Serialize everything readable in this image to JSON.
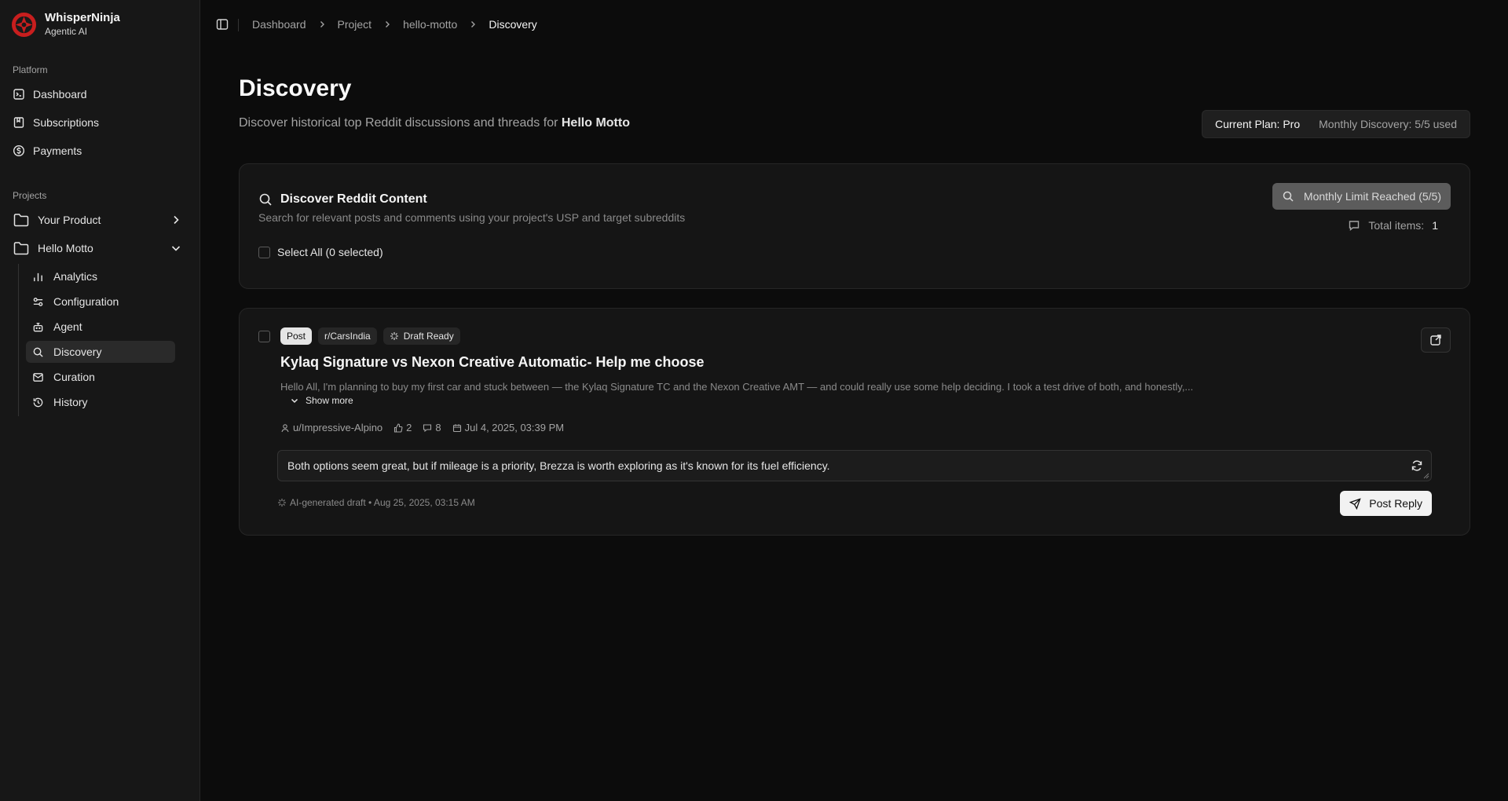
{
  "brand": {
    "name": "WhisperNinja",
    "subtitle": "Agentic AI"
  },
  "sidebar": {
    "platform_label": "Platform",
    "platform_items": [
      {
        "label": "Dashboard",
        "icon": "dashboard-icon"
      },
      {
        "label": "Subscriptions",
        "icon": "book-icon"
      },
      {
        "label": "Payments",
        "icon": "dollar-circle-icon"
      }
    ],
    "projects_label": "Projects",
    "projects": [
      {
        "label": "Your Product",
        "icon": "folder-icon",
        "state": "collapsed"
      },
      {
        "label": "Hello Motto",
        "icon": "folder-icon",
        "state": "expanded"
      }
    ],
    "sub_items": [
      {
        "label": "Analytics",
        "icon": "bar-chart-icon"
      },
      {
        "label": "Configuration",
        "icon": "sliders-icon"
      },
      {
        "label": "Agent",
        "icon": "bot-icon"
      },
      {
        "label": "Discovery",
        "icon": "search-icon",
        "active": true
      },
      {
        "label": "Curation",
        "icon": "mail-icon"
      },
      {
        "label": "History",
        "icon": "history-icon"
      }
    ]
  },
  "breadcrumb": [
    "Dashboard",
    "Project",
    "hello-motto",
    "Discovery"
  ],
  "page": {
    "title": "Discovery",
    "subtitle_prefix": "Discover historical top Reddit discussions and threads for",
    "subtitle_project": "Hello Motto",
    "plan_label": "Current Plan: Pro",
    "usage_label": "Monthly Discovery: 5/5 used"
  },
  "discover": {
    "title": "Discover Reddit Content",
    "subtitle": "Search for relevant posts and comments using your project's USP and target subreddits",
    "button_label": "Monthly Limit Reached (5/5)",
    "total_label": "Total items:",
    "total_value": "1",
    "select_all_label": "Select All (0 selected)"
  },
  "post": {
    "badges": [
      "Post",
      "r/CarsIndia",
      "Draft Ready"
    ],
    "title": "Kylaq Signature vs Nexon Creative Automatic- Help me choose",
    "body": "Hello All, I'm planning to buy my first car and stuck between — the Kylaq Signature TC and the Nexon Creative AMT — and could really use some help deciding. I took a test drive of both, and honestly,...",
    "show_more": "Show more",
    "author": "u/Impressive-Alpino",
    "upvotes": "2",
    "comments": "8",
    "date": "Jul 4, 2025, 03:39 PM",
    "reply_draft": "Both options seem great, but if mileage is a priority, Brezza is worth exploring as it's known for its fuel efficiency.",
    "ai_note": "AI-generated draft • Aug 25, 2025, 03:15 AM",
    "post_button": "Post Reply"
  },
  "colors": {
    "background": "#0c0c0c",
    "sidebar": "#171717",
    "card": "#151515",
    "accent_logo": "#c81e1e"
  }
}
